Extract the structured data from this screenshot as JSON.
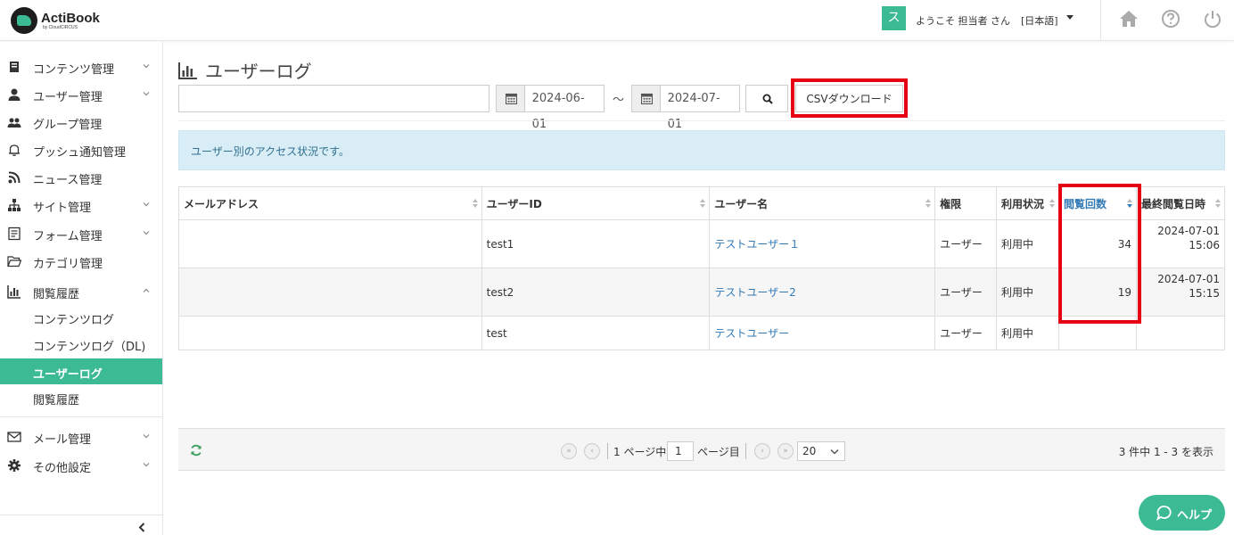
{
  "header": {
    "logo_name": "ActiBook",
    "logo_sub": "by CloudCIRCUS",
    "avatar": "ス",
    "welcome": "ようこそ 担当者 さん",
    "language": "[日本語]",
    "icons": [
      "home-icon",
      "help-icon",
      "power-icon"
    ]
  },
  "sidebar": {
    "items": [
      {
        "label": "コンテンツ管理",
        "icon": "book-icon",
        "chevron": "down"
      },
      {
        "label": "ユーザー管理",
        "icon": "user-icon",
        "chevron": "down"
      },
      {
        "label": "グループ管理",
        "icon": "users-icon"
      },
      {
        "label": "プッシュ通知管理",
        "icon": "bell-icon"
      },
      {
        "label": "ニュース管理",
        "icon": "rss-icon"
      },
      {
        "label": "サイト管理",
        "icon": "sitemap-icon",
        "chevron": "down"
      },
      {
        "label": "フォーム管理",
        "icon": "form-icon",
        "chevron": "down"
      },
      {
        "label": "カテゴリ管理",
        "icon": "folder-icon"
      },
      {
        "label": "閲覧履歴",
        "icon": "bar-chart-icon",
        "chevron": "up"
      }
    ],
    "sub_items": [
      {
        "label": "コンテンツログ"
      },
      {
        "label": "コンテンツログ（DL)"
      },
      {
        "label": "ユーザーログ",
        "active": true
      },
      {
        "label": "閲覧履歴"
      }
    ],
    "bottom_items": [
      {
        "label": "メール管理",
        "icon": "mail-icon",
        "chevron": "down"
      },
      {
        "label": "その他設定",
        "icon": "gear-icon",
        "chevron": "down"
      }
    ]
  },
  "main": {
    "title": "ユーザーログ",
    "search_placeholder": "",
    "date_from": "2024-06-01",
    "date_sep": "〜",
    "date_to": "2024-07-01",
    "csv_button": "CSVダウンロード",
    "info": "ユーザー別のアクセス状況です。"
  },
  "table": {
    "headers": [
      "メールアドレス",
      "ユーザーID",
      "ユーザー名",
      "権限",
      "利用状況",
      "閲覧回数",
      "最終閲覧日時"
    ],
    "sorted_column": "閲覧回数",
    "rows": [
      {
        "email": "",
        "user_id": "test1",
        "user_name": "テストユーザー１",
        "role": "ユーザー",
        "status": "利用中",
        "views": "34",
        "last_date": "2024-07-01",
        "last_time": "15:06"
      },
      {
        "email": "",
        "user_id": "test2",
        "user_name": "テストユーザー2",
        "role": "ユーザー",
        "status": "利用中",
        "views": "19",
        "last_date": "2024-07-01",
        "last_time": "15:15"
      },
      {
        "email": "",
        "user_id": "test",
        "user_name": "テストユーザー",
        "role": "ユーザー",
        "status": "利用中",
        "views": "",
        "last_date": "",
        "last_time": ""
      }
    ]
  },
  "pager": {
    "prefix": "1 ページ中",
    "page": "1",
    "suffix": "ページ目",
    "first": "«",
    "prev": "‹",
    "next": "›",
    "last": "»",
    "per_page": "20",
    "count": "3 件中 1 - 3 を表示"
  },
  "help_button": "ヘルプ",
  "colors": {
    "accent": "#3cba94",
    "highlight": "#e60012",
    "link": "#337ab7",
    "info_bg": "#d9edf7"
  }
}
